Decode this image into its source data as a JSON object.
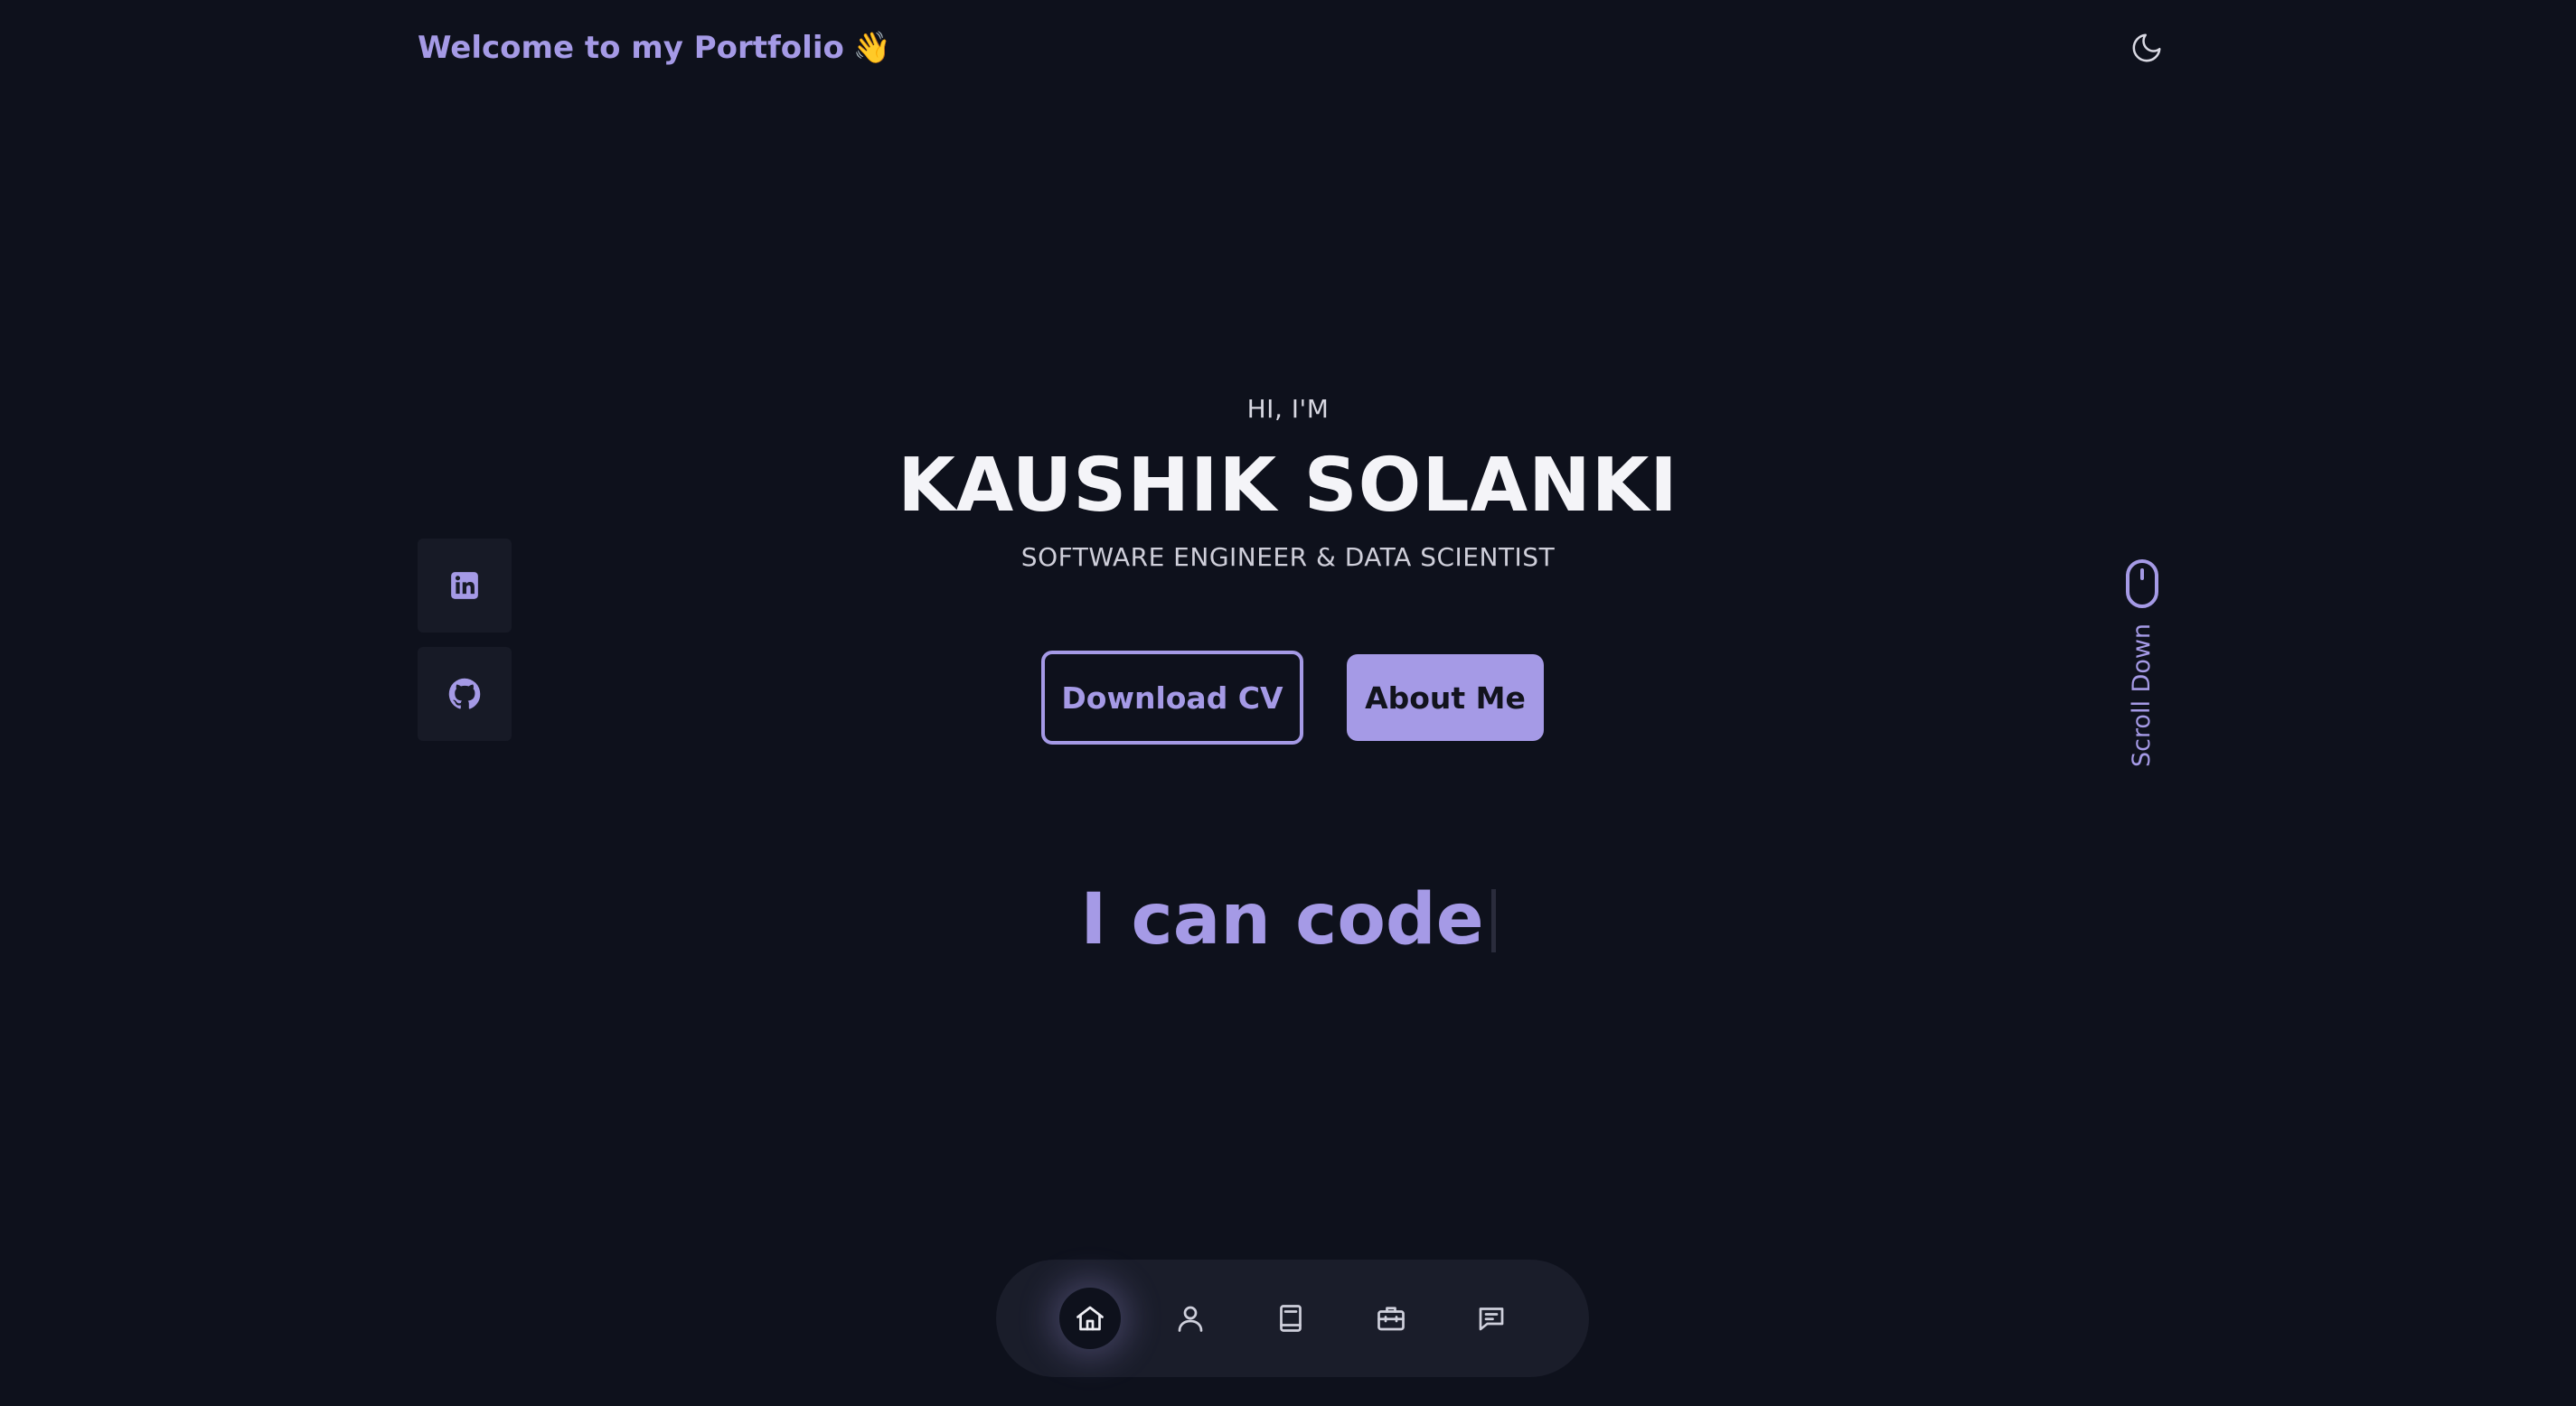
{
  "header": {
    "brand_text": "Welcome to my Portfolio",
    "brand_emoji": "👋",
    "theme_toggle_icon": "moon-icon"
  },
  "hero": {
    "greeting": "HI, I'M",
    "name": "KAUSHIK SOLANKI",
    "role": "SOFTWARE ENGINEER & DATA SCIENTIST",
    "download_cv_label": "Download CV",
    "about_me_label": "About Me",
    "typed_text": "I can code"
  },
  "social": [
    {
      "icon": "linkedin-icon"
    },
    {
      "icon": "github-icon"
    }
  ],
  "scroll": {
    "label": "Scroll Down",
    "icon": "mouse-icon"
  },
  "bottom_nav": [
    {
      "icon": "home-icon",
      "active": true
    },
    {
      "icon": "user-icon",
      "active": false
    },
    {
      "icon": "book-icon",
      "active": false
    },
    {
      "icon": "briefcase-icon",
      "active": false
    },
    {
      "icon": "message-icon",
      "active": false
    }
  ],
  "colors": {
    "background": "#0e111c",
    "accent": "#a59ae6",
    "surface": "#171a26",
    "nav_background": "#1a1d2a",
    "text": "#f4f4f8"
  }
}
